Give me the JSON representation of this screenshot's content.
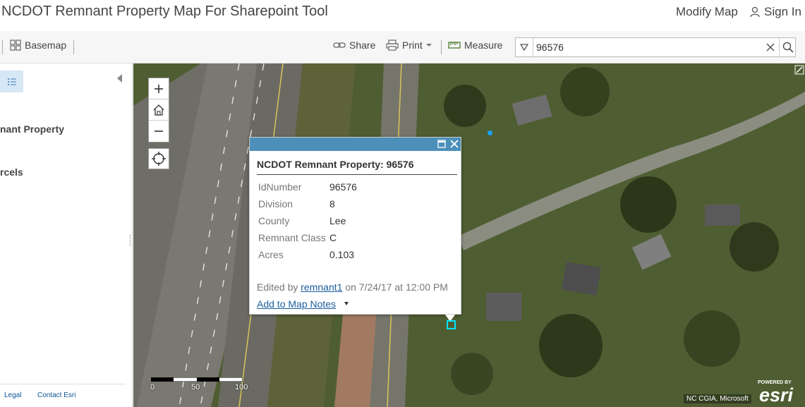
{
  "header": {
    "app_title": "NCDOT Remnant Property Map For Sharepoint Tool",
    "modify_map": "Modify Map",
    "sign_in": "Sign In"
  },
  "toolbar": {
    "basemap": "Basemap",
    "share": "Share",
    "print": "Print",
    "measure": "Measure"
  },
  "search": {
    "value": "96576"
  },
  "sidebar": {
    "layers": [
      "nant Property",
      "rcels"
    ],
    "footer": {
      "legal": "Legal",
      "contact": "Contact Esri"
    }
  },
  "popup": {
    "title": "NCDOT Remnant Property: 96576",
    "attributes": [
      {
        "name": "IdNumber",
        "value": "96576"
      },
      {
        "name": "Division",
        "value": "8"
      },
      {
        "name": "County",
        "value": "Lee"
      },
      {
        "name": "Remnant Class",
        "value": "C"
      },
      {
        "name": "Acres",
        "value": "0.103"
      }
    ],
    "edited_prefix": "Edited by",
    "edited_user": "remnant1",
    "edited_suffix": "on 7/24/17 at 12:00 PM",
    "add_notes": "Add to Map Notes"
  },
  "map": {
    "scale_labels": [
      "0",
      "50",
      "100"
    ],
    "attribution": "NC CGIA, Microsoft",
    "esri_powered": "POWERED BY",
    "esri_name": "esri",
    "selection_color": "#00e5ff",
    "popup_header_color": "#4c90ba"
  }
}
